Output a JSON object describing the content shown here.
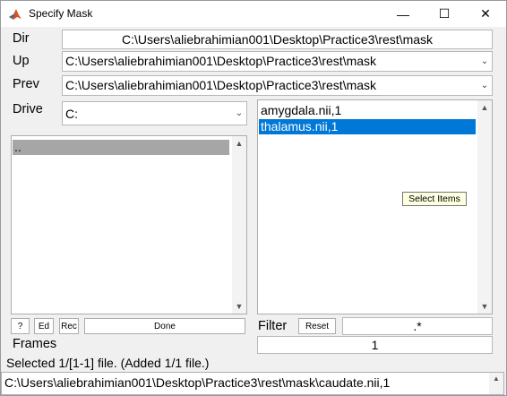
{
  "window": {
    "title": "Specify Mask",
    "icon": "matlab-icon",
    "controls": {
      "minimize": "—",
      "maximize": "☐",
      "close": "✕"
    }
  },
  "labels": {
    "dir": "Dir",
    "up": "Up",
    "prev": "Prev",
    "drive": "Drive",
    "filter": "Filter",
    "frames": "Frames"
  },
  "dir_value": "C:\\Users\\aliebrahimian001\\Desktop\\Practice3\\rest\\mask",
  "up_value": "C:\\Users\\aliebrahimian001\\Desktop\\Practice3\\rest\\mask",
  "prev_value": "C:\\Users\\aliebrahimian001\\Desktop\\Practice3\\rest\\mask",
  "drive_value": "C:",
  "dir_list": {
    "items": [
      ".."
    ]
  },
  "file_list": {
    "items": [
      "amygdala.nii,1",
      "thalamus.nii,1"
    ],
    "selected_index": 1
  },
  "tooltip": "Select Items",
  "buttons": {
    "help": "?",
    "ed": "Ed",
    "rec": "Rec",
    "done": "Done",
    "reset": "Reset"
  },
  "filter_value": ".*",
  "frames_value": "1",
  "status": "Selected 1/[1-1] file. (Added 1/1 file.)",
  "selected_path": "C:\\Users\\aliebrahimian001\\Desktop\\Practice3\\rest\\mask\\caudate.nii,1",
  "colors": {
    "selection_bg": "#0078d7",
    "dir_item_bg": "#a6a6a6",
    "tooltip_bg": "#ffffe1"
  }
}
